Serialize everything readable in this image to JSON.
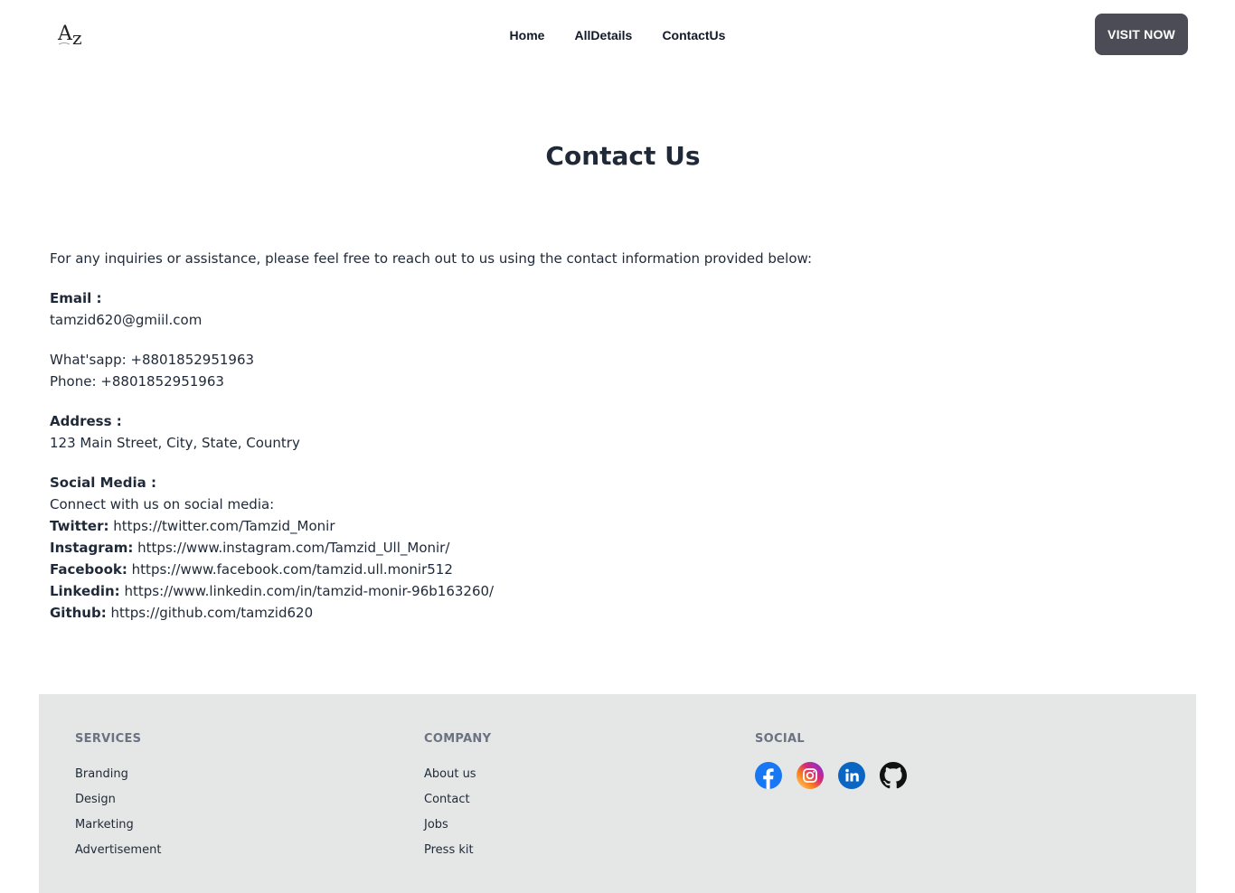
{
  "nav": {
    "logo_text": "Az",
    "links": [
      "Home",
      "AllDetails",
      "ContactUs"
    ],
    "cta_label": "VISIT NOW"
  },
  "page": {
    "title": "Contact Us",
    "intro": "For any inquiries or assistance, please feel free to reach out to us using the contact information provided below:",
    "email_label": "Email :",
    "email_value": "tamzid620@gmiil.com",
    "whatsapp": "What'sapp: +8801852951963",
    "phone": "Phone: +8801852951963",
    "address_label": "Address :",
    "address_value": "123 Main Street, City, State, Country",
    "social_label": "Social Media :",
    "social_intro": "Connect with us on social media:",
    "socials": [
      {
        "label": "Twitter:",
        "value": "https://twitter.com/Tamzid_Monir"
      },
      {
        "label": "Instagram:",
        "value": "https://www.instagram.com/Tamzid_Ull_Monir/"
      },
      {
        "label": "Facebook:",
        "value": "https://www.facebook.com/tamzid.ull.monir512"
      },
      {
        "label": "Linkedin:",
        "value": "https://www.linkedin.com/in/tamzid-monir-96b163260/"
      },
      {
        "label": "Github:",
        "value": "https://github.com/tamzid620"
      }
    ]
  },
  "footer": {
    "services": {
      "heading": "SERVICES",
      "items": [
        "Branding",
        "Design",
        "Marketing",
        "Advertisement"
      ]
    },
    "company": {
      "heading": "COMPANY",
      "items": [
        "About us",
        "Contact",
        "Jobs",
        "Press kit"
      ]
    },
    "social": {
      "heading": "SOCIAL",
      "icons": [
        "facebook-icon",
        "instagram-icon",
        "linkedin-icon",
        "github-icon"
      ]
    }
  },
  "colors": {
    "cta_bg": "#4b4c55",
    "footer_bg": "#e5e7e7",
    "facebook": "#1877f2",
    "linkedin": "#0a66c2"
  }
}
